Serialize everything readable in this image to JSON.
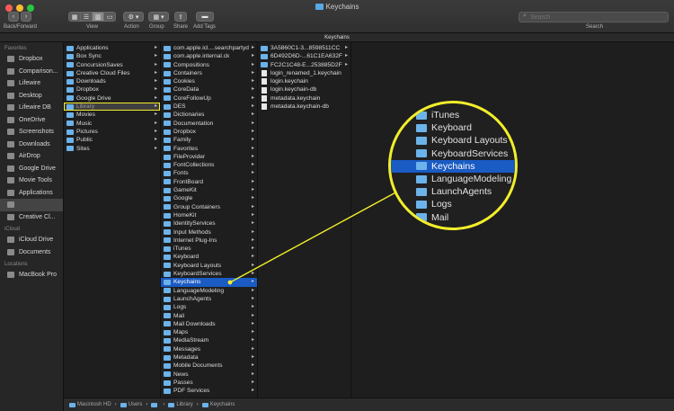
{
  "window": {
    "title": "Keychains",
    "traffic_light_colors": [
      "#fd5c55",
      "#fdbb2e",
      "#28c840"
    ]
  },
  "toolbar": {
    "back_forward_label": "Back/Forward",
    "view_label": "View",
    "action_label": "Action",
    "group_label": "Group",
    "share_label": "Share",
    "add_tags_label": "Add Tags",
    "search_placeholder": "Search",
    "search_label": "Search"
  },
  "tab": {
    "title": "Keychains"
  },
  "sidebar": {
    "favorites_header": "Favorites",
    "favorites": [
      {
        "label": "Dropbox",
        "icon": "dropbox-icon"
      },
      {
        "label": "Comparison...",
        "icon": "folder-icon"
      },
      {
        "label": "Lifewire",
        "icon": "folder-icon"
      },
      {
        "label": "Desktop",
        "icon": "desktop-icon"
      },
      {
        "label": "Lifewire DB",
        "icon": "folder-icon"
      },
      {
        "label": "OneDrive",
        "icon": "folder-icon"
      },
      {
        "label": "Screenshots",
        "icon": "folder-icon"
      },
      {
        "label": "Downloads",
        "icon": "downloads-icon"
      },
      {
        "label": "AirDrop",
        "icon": "airdrop-icon"
      },
      {
        "label": "Google Drive",
        "icon": "folder-icon"
      },
      {
        "label": "Movie Tools",
        "icon": "folder-icon"
      },
      {
        "label": "Applications",
        "icon": "applications-icon"
      },
      {
        "label": "",
        "icon": "home-icon"
      },
      {
        "label": "Creative Cl...",
        "icon": "folder-icon"
      }
    ],
    "icloud_header": "iCloud",
    "icloud": [
      {
        "label": "iCloud Drive",
        "icon": "cloud-icon"
      },
      {
        "label": "Documents",
        "icon": "folder-icon"
      }
    ],
    "locations_header": "Locations",
    "locations": [
      {
        "label": "MacBook Pro",
        "icon": "laptop-icon"
      }
    ]
  },
  "columns": {
    "home": [
      {
        "label": "Applications",
        "arrow": "▸"
      },
      {
        "label": "Box Sync",
        "arrow": "▸"
      },
      {
        "label": "ConcursionSaves",
        "arrow": "▸"
      },
      {
        "label": "Creative Cloud Files",
        "arrow": "▸"
      },
      {
        "label": "Downloads",
        "arrow": "▸"
      },
      {
        "label": "Dropbox",
        "arrow": "▸"
      },
      {
        "label": "Google Drive",
        "arrow": "▸"
      },
      {
        "label": "Library",
        "arrow": "▸"
      },
      {
        "label": "Movies",
        "arrow": "▸"
      },
      {
        "label": "Music",
        "arrow": "▸"
      },
      {
        "label": "Pictures",
        "arrow": "▸"
      },
      {
        "label": "Public",
        "arrow": "▸"
      },
      {
        "label": "Sites",
        "arrow": "▸"
      }
    ],
    "library": [
      {
        "label": "com.apple.icl....searchpartyd",
        "arrow": "▸"
      },
      {
        "label": "com.apple.internal.ck",
        "arrow": "▸"
      },
      {
        "label": "Compositions",
        "arrow": "▸"
      },
      {
        "label": "Containers",
        "arrow": "▸"
      },
      {
        "label": "Cookies",
        "arrow": "▸"
      },
      {
        "label": "CoreData",
        "arrow": "▸"
      },
      {
        "label": "CoreFollowUp",
        "arrow": "▸"
      },
      {
        "label": "DES",
        "arrow": "▸"
      },
      {
        "label": "Dictionaries",
        "arrow": "▸"
      },
      {
        "label": "Documentation",
        "arrow": "▸"
      },
      {
        "label": "Dropbox",
        "arrow": "▸"
      },
      {
        "label": "Family",
        "arrow": "▸"
      },
      {
        "label": "Favorites",
        "arrow": "▸"
      },
      {
        "label": "FileProvider",
        "arrow": "▸"
      },
      {
        "label": "FontCollections",
        "arrow": "▸"
      },
      {
        "label": "Fonts",
        "arrow": "▸"
      },
      {
        "label": "FrontBoard",
        "arrow": "▸"
      },
      {
        "label": "GameKit",
        "arrow": "▸"
      },
      {
        "label": "Google",
        "arrow": "▸"
      },
      {
        "label": "Group Containers",
        "arrow": "▸"
      },
      {
        "label": "HomeKit",
        "arrow": "▸"
      },
      {
        "label": "IdentityServices",
        "arrow": "▸"
      },
      {
        "label": "Input Methods",
        "arrow": "▸"
      },
      {
        "label": "Internet Plug-Ins",
        "arrow": "▸"
      },
      {
        "label": "iTunes",
        "arrow": "▸"
      },
      {
        "label": "Keyboard",
        "arrow": "▸"
      },
      {
        "label": "Keyboard Layouts",
        "arrow": "▸"
      },
      {
        "label": "KeyboardServices",
        "arrow": "▸"
      },
      {
        "label": "Keychains",
        "arrow": "▸"
      },
      {
        "label": "LanguageModeling",
        "arrow": "▸"
      },
      {
        "label": "LaunchAgents",
        "arrow": "▸"
      },
      {
        "label": "Logs",
        "arrow": "▸"
      },
      {
        "label": "Mail",
        "arrow": "▸"
      },
      {
        "label": "Mail Downloads",
        "arrow": "▸"
      },
      {
        "label": "Maps",
        "arrow": "▸"
      },
      {
        "label": "MediaStream",
        "arrow": "▸"
      },
      {
        "label": "Messages",
        "arrow": "▸"
      },
      {
        "label": "Metadata",
        "arrow": "▸"
      },
      {
        "label": "Mobile Documents",
        "arrow": "▸"
      },
      {
        "label": "News",
        "arrow": "▸"
      },
      {
        "label": "Passes",
        "arrow": "▸"
      },
      {
        "label": "PDF Services",
        "arrow": "▸"
      }
    ],
    "keychains": [
      {
        "label": "3A5860C1-3...8598511CC",
        "arrow": "▸",
        "kind": "folder"
      },
      {
        "label": "6D492D6D-...61C1EA632F",
        "arrow": "▸",
        "kind": "folder"
      },
      {
        "label": "FC2C1C48-E...253885D2F",
        "arrow": "▸",
        "kind": "folder"
      },
      {
        "label": "login_renamed_1.keychain",
        "arrow": "",
        "kind": "doc"
      },
      {
        "label": "login.keychain",
        "arrow": "",
        "kind": "doc"
      },
      {
        "label": "login.keychain-db",
        "arrow": "",
        "kind": "doc"
      },
      {
        "label": "metadata.keychain",
        "arrow": "",
        "kind": "doc"
      },
      {
        "label": "metadata.keychain-db",
        "arrow": "",
        "kind": "doc"
      }
    ]
  },
  "magnifier": {
    "rows": [
      "iTunes",
      "Keyboard",
      "Keyboard Layouts",
      "KeyboardServices",
      "Keychains",
      "LanguageModeling",
      "LaunchAgents",
      "Logs",
      "Mail"
    ],
    "selected_index": 4,
    "color": "#f2ee2b"
  },
  "pathbar": {
    "items": [
      "Macintosh HD",
      "Users",
      "",
      "Library",
      "Keychains"
    ]
  },
  "colors": {
    "selection": "#1a5bc4",
    "folder": "#6bb3ea",
    "highlight": "#f2ee2b"
  }
}
